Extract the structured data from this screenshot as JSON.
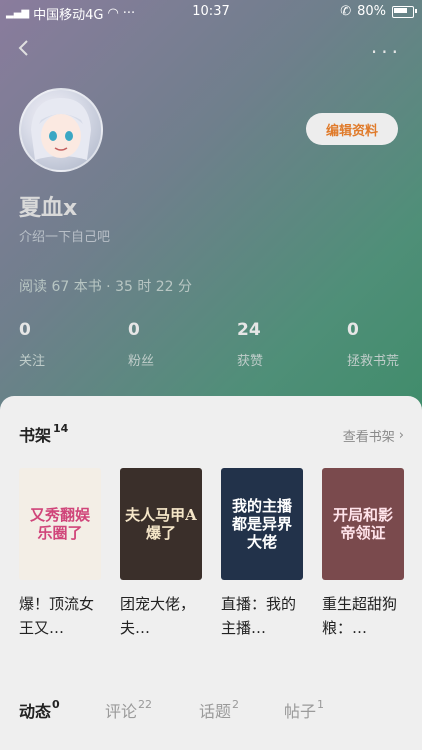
{
  "status_bar": {
    "carrier": "中国移动4G",
    "time": "10:37",
    "battery": "80%"
  },
  "profile": {
    "username": "夏血x",
    "bio": "介绍一下自己吧",
    "reading_stats": "阅读 67 本书 · 35 时 22 分",
    "edit_label": "编辑资料"
  },
  "stats": [
    {
      "value": "0",
      "label": "关注"
    },
    {
      "value": "0",
      "label": "粉丝"
    },
    {
      "value": "24",
      "label": "获赞"
    },
    {
      "value": "0",
      "label": "拯救书荒"
    }
  ],
  "bookshelf": {
    "title": "书架",
    "count": "14",
    "view_label": "查看书架",
    "books": [
      {
        "title": "爆！顶流女王又…",
        "cover_text": "又秀翻娱乐圈了",
        "cover_bg": "#f3eee6",
        "cover_fg": "#d0457a"
      },
      {
        "title": "团宠大佬，夫…",
        "cover_text": "夫人马甲A爆了",
        "cover_bg": "#3a2f2a",
        "cover_fg": "#f5e6c8"
      },
      {
        "title": "直播：我的主播…",
        "cover_text": "我的主播都是异界大佬",
        "cover_bg": "#22324a",
        "cover_fg": "#ffffff"
      },
      {
        "title": "重生超甜狗粮：…",
        "cover_text": "开局和影帝领证",
        "cover_bg": "#7a4a4d",
        "cover_fg": "#ffe3ea"
      }
    ]
  },
  "tabs": [
    {
      "label": "动态",
      "count": "0",
      "active": true
    },
    {
      "label": "评论",
      "count": "22",
      "active": false
    },
    {
      "label": "话题",
      "count": "2",
      "active": false
    },
    {
      "label": "帖子",
      "count": "1",
      "active": false
    }
  ]
}
